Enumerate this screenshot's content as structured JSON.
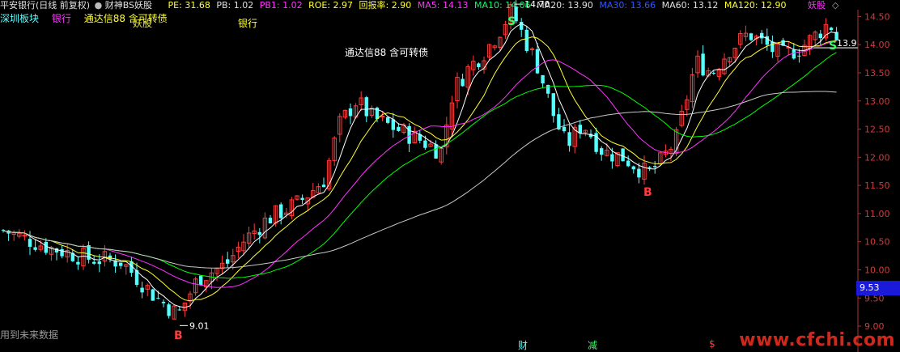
{
  "header": {
    "stock": "平安银行(日线 前复权)",
    "indicator": "财神BS妖股",
    "pe": "PE: 31.68",
    "pb": "PB: 1.02",
    "pb1": "PB1: 1.02",
    "roe": "ROE: 2.97",
    "huibao": "回报率: 2.90",
    "ma5": "MA5: 14.13",
    "ma10": "MA10: 14.06",
    "ma20": "MA20: 13.90",
    "ma30": "MA30: 13.66",
    "ma60": "MA60: 13.12",
    "ma120": "MA120: 12.90",
    "yaogu": "妖股",
    "marker": "◇"
  },
  "row2": {
    "shenzhen": "深圳板块",
    "bank": "银行",
    "tdx": "通达信88 含可转债",
    "overlay": "妖股",
    "bank2": "银行"
  },
  "chart_data": {
    "type": "candlestick",
    "ylim": [
      8.9,
      14.65
    ],
    "yticks": [
      "14.50",
      "14.00",
      "13.50",
      "13.00",
      "12.50",
      "12.00",
      "11.50",
      "11.00",
      "10.50",
      "10.00",
      "9.50",
      "9.00"
    ],
    "annotation": "通达信88 含可转债",
    "high_label": "14.70",
    "low_label": "9.01",
    "last_price": "9.53",
    "right_price": "13.9",
    "signals": [
      "B",
      "S",
      "B",
      "S"
    ],
    "colors": {
      "up": "#ff3b3b",
      "down": "#54ffff",
      "ma5": "#ffffff",
      "ma10": "#ffff33",
      "ma20": "#ff33ff",
      "ma30": "#00ff00",
      "ma60": "#c8c8c8"
    }
  },
  "footer": {
    "future": "用到未来数据",
    "cai": "财",
    "jian": "减",
    "dollar": "$",
    "site": "www.cfchi.com"
  }
}
